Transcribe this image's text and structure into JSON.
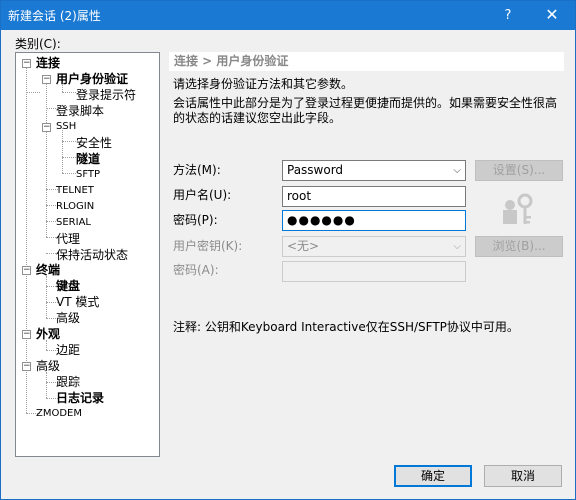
{
  "window": {
    "title": "新建会话 (2)属性",
    "help_glyph": "?",
    "close_glyph": "✕"
  },
  "category_label": "类别(C):",
  "tree": {
    "items": [
      {
        "label": "连接"
      },
      {
        "label": "用户身份验证"
      },
      {
        "label": "登录提示符"
      },
      {
        "label": "登录脚本"
      },
      {
        "label": "SSH"
      },
      {
        "label": "安全性"
      },
      {
        "label": "隧道"
      },
      {
        "label": "SFTP"
      },
      {
        "label": "TELNET"
      },
      {
        "label": "RLOGIN"
      },
      {
        "label": "SERIAL"
      },
      {
        "label": "代理"
      },
      {
        "label": "保持活动状态"
      },
      {
        "label": "终端"
      },
      {
        "label": "键盘"
      },
      {
        "label": "VT 模式"
      },
      {
        "label": "高级"
      },
      {
        "label": "外观"
      },
      {
        "label": "边距"
      },
      {
        "label": "高级"
      },
      {
        "label": "跟踪"
      },
      {
        "label": "日志记录"
      },
      {
        "label": "ZMODEM"
      }
    ],
    "toggle_glyph": "−"
  },
  "panel": {
    "header": "连接 > 用户身份验证",
    "desc1": "请选择身份验证方法和其它参数。",
    "desc2_line1": "会话属性中此部分是为了登录过程更便捷而提供的。如果需要安全性很高",
    "desc2_line2": "的状态的话建议您空出此字段。"
  },
  "form": {
    "method": {
      "label": "方法(M):",
      "value": "Password"
    },
    "setup_button": "设置(S)...",
    "username": {
      "label": "用户名(U):",
      "value": "root"
    },
    "password": {
      "label": "密码(P):",
      "value": "●●●●●●"
    },
    "user_key": {
      "label": "用户密钥(K):",
      "value": "<无>"
    },
    "browse_button": "浏览(B)...",
    "passphrase": {
      "label": "密码(A):",
      "value": ""
    },
    "dropdown_glyph": "⌵"
  },
  "note": "注释: 公钥和Keyboard Interactive仅在SSH/SFTP协议中可用。",
  "buttons": {
    "ok": "确定",
    "cancel": "取消"
  },
  "colors": {
    "titlebar": "#1979d3",
    "accent": "#0078d7",
    "disabled_text": "#8c8c8c"
  }
}
